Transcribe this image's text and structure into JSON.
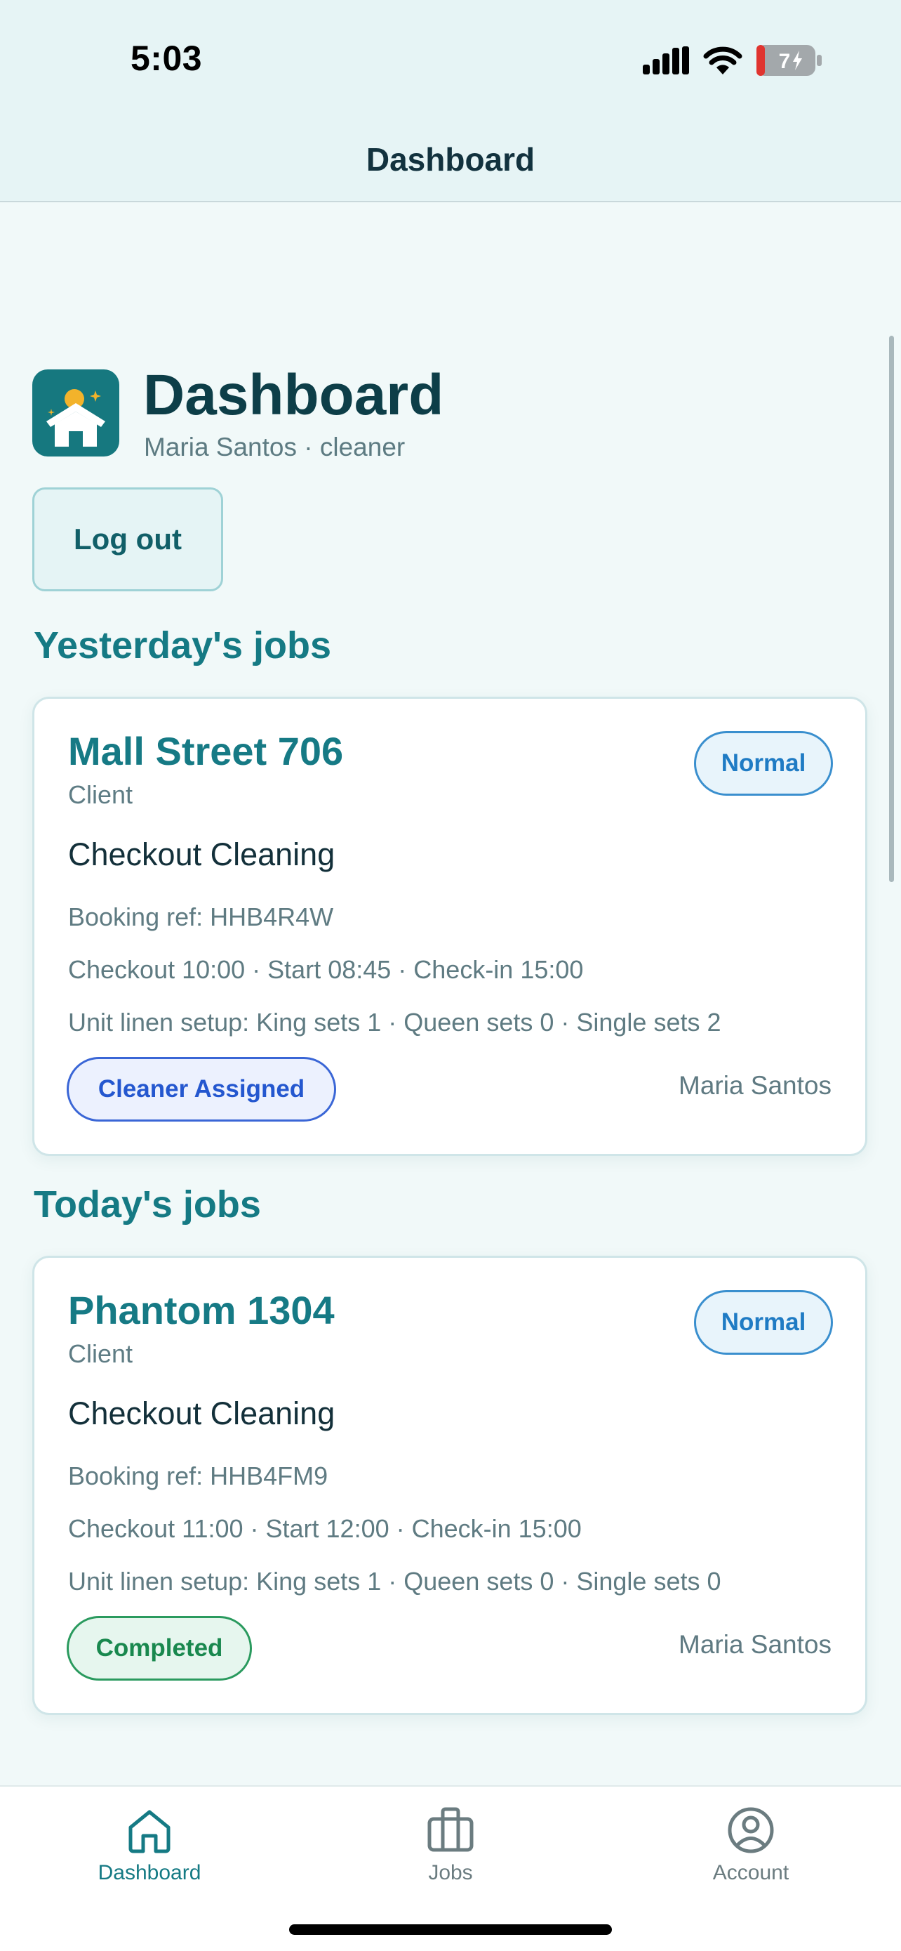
{
  "status_bar": {
    "time": "5:03",
    "battery_level": "7",
    "icons": [
      "signal-icon",
      "wifi-icon",
      "battery-icon"
    ]
  },
  "nav": {
    "title": "Dashboard"
  },
  "header": {
    "logo_icon": "home-sun-logo",
    "title": "Dashboard",
    "user_line": "Maria Santos · cleaner",
    "logout_label": "Log out"
  },
  "sections": [
    {
      "title": "Yesterday's jobs",
      "jobs": [
        {
          "property": "Mall Street 706",
          "client": "Client",
          "priority": "Normal",
          "service": "Checkout Cleaning",
          "booking_ref": "Booking ref: HHB4R4W",
          "times": "Checkout 10:00 · Start 08:45 · Check-in 15:00",
          "linen": "Unit linen setup: King sets 1 · Queen sets 0 · Single sets 2",
          "status": "Cleaner Assigned",
          "assignee": "Maria Santos"
        }
      ]
    },
    {
      "title": "Today's jobs",
      "jobs": [
        {
          "property": "Phantom 1304",
          "client": "Client",
          "priority": "Normal",
          "service": "Checkout Cleaning",
          "booking_ref": "Booking ref: HHB4FM9",
          "times": "Checkout 11:00 · Start 12:00 · Check-in 15:00",
          "linen": "Unit linen setup: King sets 1 · Queen sets 0 · Single sets 0",
          "status": "Completed",
          "assignee": "Maria Santos"
        }
      ]
    }
  ],
  "tabs": [
    {
      "label": "Dashboard",
      "icon": "home-icon",
      "active": true
    },
    {
      "label": "Jobs",
      "icon": "briefcase-icon",
      "active": false
    },
    {
      "label": "Account",
      "icon": "account-icon",
      "active": false
    }
  ],
  "colors": {
    "accent": "#157a84",
    "header_bg": "#e6f4f5",
    "page_bg": "#f1f9f9",
    "priority_blue": "#1f7bc4",
    "assigned_blue": "#2457cf",
    "completed_green": "#19884e",
    "battery_low": "#e0342f"
  }
}
